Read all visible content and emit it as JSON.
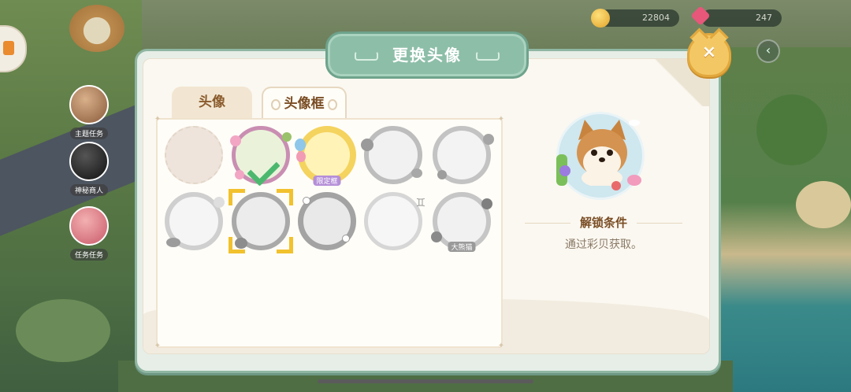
{
  "hud": {
    "coins": "22804",
    "gems": "247",
    "left_icons": [
      "主题任务",
      "神秘商人",
      "任务任务"
    ]
  },
  "dialog": {
    "title": "更换头像",
    "close_label": "×"
  },
  "tabs": [
    {
      "label": "头像",
      "active": false
    },
    {
      "label": "头像框",
      "active": true
    }
  ],
  "frames": [
    {
      "name": "empty",
      "tag": "",
      "equipped": false,
      "selected": false
    },
    {
      "name": "flower-wreath",
      "tag": "",
      "equipped": true,
      "selected": false
    },
    {
      "name": "balloon-party",
      "tag": "限定框",
      "equipped": false,
      "selected": false
    },
    {
      "name": "tropical-leaf",
      "tag": "",
      "equipped": false,
      "selected": false
    },
    {
      "name": "garden-gate",
      "tag": "",
      "equipped": false,
      "selected": false
    },
    {
      "name": "blossom-cloud",
      "tag": "",
      "equipped": false,
      "selected": false
    },
    {
      "name": "seashell",
      "tag": "",
      "equipped": false,
      "selected": true
    },
    {
      "name": "pearl-vine",
      "tag": "",
      "equipped": false,
      "selected": false
    },
    {
      "name": "gemini-mark",
      "tag": "",
      "equipped": false,
      "selected": false
    },
    {
      "name": "panda-friends",
      "tag": "大熊猫",
      "equipped": false,
      "selected": false
    }
  ],
  "preview": {
    "unlock_title": "解锁条件",
    "unlock_text": "通过彩贝获取。"
  },
  "colors": {
    "accent": "#8dbea8",
    "equipped_check": "#4cb86f",
    "selection": "#f2c12e",
    "close": "#f3c864"
  }
}
